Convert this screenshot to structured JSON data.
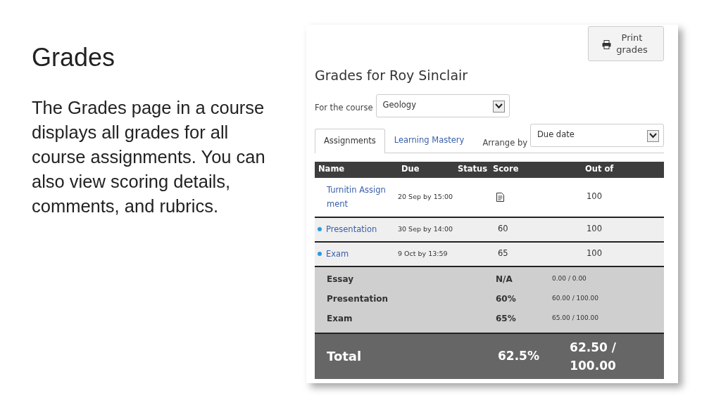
{
  "slide": {
    "title": "Grades",
    "body": "The Grades page in a course displays all grades for all course assignments. You can also view scoring details, comments, and rubrics."
  },
  "print_button": {
    "label": "Print grades"
  },
  "page_title": "Grades for Roy Sinclair",
  "course": {
    "label": "For the course",
    "value": "Geology"
  },
  "tabs": [
    {
      "label": "Assignments",
      "selected": true
    },
    {
      "label": "Learning Mastery",
      "selected": false
    }
  ],
  "arrange": {
    "label": "Arrange by",
    "value": "Due date"
  },
  "table": {
    "columns": [
      "Name",
      "Due",
      "Status",
      "Score",
      "Out of"
    ],
    "rows": [
      {
        "name": "Turnitin Assign ment",
        "due": "20 Sep by 15:00",
        "kind": "submitted",
        "out_of": "100",
        "unread": false
      },
      {
        "name": "Presentation",
        "due": "30 Sep by 14:00",
        "kind": "scored",
        "score": "60",
        "out_of": "100",
        "unread": true
      },
      {
        "name": "Exam",
        "due": "9 Oct by 13:59",
        "kind": "scored",
        "score": "65",
        "out_of": "100",
        "unread": true
      }
    ]
  },
  "summary": [
    {
      "name": "Essay",
      "percent": "N/A",
      "points": "0.00 / 0.00"
    },
    {
      "name": "Presentation",
      "percent": "60%",
      "points": "60.00 / 100.00"
    },
    {
      "name": "Exam",
      "percent": "65%",
      "points": "65.00 / 100.00"
    }
  ],
  "total": {
    "label": "Total",
    "percent": "62.5%",
    "points": "62.50 / 100.00"
  }
}
